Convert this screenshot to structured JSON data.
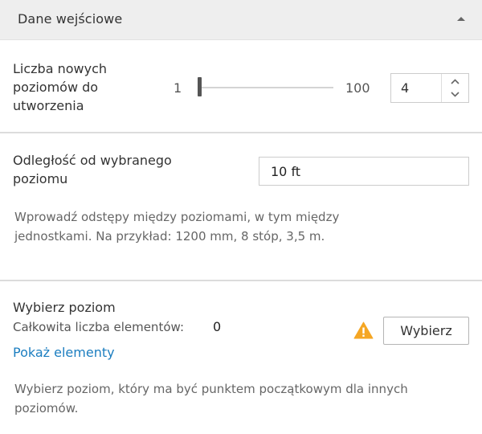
{
  "panel": {
    "title": "Dane wejściowe"
  },
  "levels": {
    "label_lines": [
      "Liczba nowych",
      "poziomów do",
      "utworzenia"
    ],
    "slider": {
      "min": "1",
      "max": "100",
      "value": 4
    },
    "stepper_value": "4"
  },
  "distance": {
    "label_lines": [
      "Odległość od wybranego",
      "poziomu"
    ],
    "value": "10 ft",
    "hint_lines": [
      "Wprowadź odstępy między poziomami, w tym między",
      "jednostkami. Na przykład: 1200 mm, 8 stóp, 3,5 m."
    ]
  },
  "select_level": {
    "label": "Wybierz poziom",
    "count_label": "Całkowita liczba elementów:",
    "count_value": "0",
    "show_link": "Pokaż elementy",
    "button_label": "Wybierz",
    "hint_lines": [
      "Wybierz poziom, który ma być punktem początkowym dla innych",
      "poziomów."
    ]
  },
  "icons": {
    "collapse": "caret-up-icon",
    "stepper_up": "chevron-up-icon",
    "stepper_down": "chevron-down-icon",
    "warning": "warning-icon"
  },
  "colors": {
    "header_bg": "#eeeeee",
    "link": "#1c7ec0",
    "warning": "#f5a623"
  }
}
